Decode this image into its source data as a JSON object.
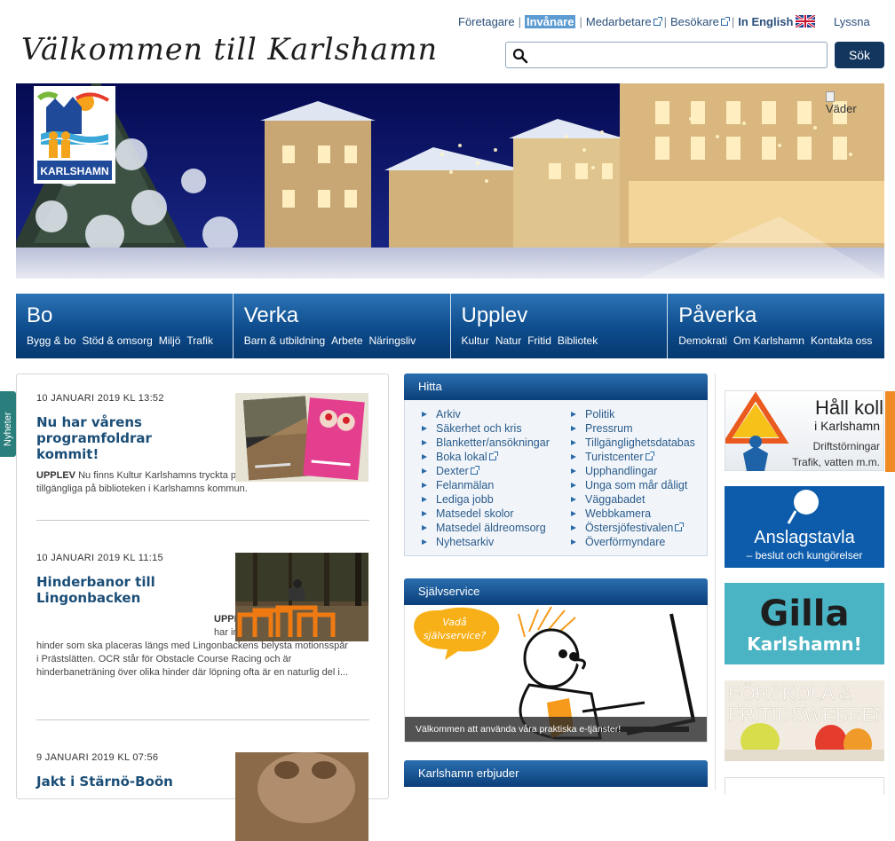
{
  "topnav": {
    "items": [
      "Företagare",
      "Invånare",
      "Medarbetare",
      "Besökare",
      "In English"
    ],
    "lyssna": "Lyssna"
  },
  "header": {
    "headline": "Välkommen till Karlshamn",
    "search_placeholder": "",
    "search_button": "Sök"
  },
  "hero": {
    "logo_text": "KARLSHAMN",
    "weather_alt": "Väder"
  },
  "mainnav": [
    {
      "title": "Bo",
      "subs": [
        "Bygg & bo",
        "Stöd & omsorg",
        "Miljö",
        "Trafik"
      ]
    },
    {
      "title": "Verka",
      "subs": [
        "Barn & utbildning",
        "Arbete",
        "Näringsliv"
      ]
    },
    {
      "title": "Upplev",
      "subs": [
        "Kultur",
        "Natur",
        "Fritid",
        "Bibliotek"
      ]
    },
    {
      "title": "Påverka",
      "subs": [
        "Demokrati",
        "Om Karlshamn",
        "Kontakta oss"
      ]
    }
  ],
  "sidetab": "Nyheter",
  "news": [
    {
      "date": "10 JANUARI 2019 KL 13:52",
      "title": "Nu har vårens programfoldrar kommit!",
      "category": "UPPLEV",
      "text": "Nu finns Kultur Karlshamns tryckta programfoldrar för våren tillgängliga på biblioteken i Karlshamns kommun."
    },
    {
      "date": "10 JANUARI 2019 KL 11:15",
      "title": "Hinderbanor till Lingonbacken",
      "category": "UPPLEV",
      "text": "Karlshamns kommun har inhandlat 12 stycken OCR-hinder som ska placeras längs med Lingonbackens belysta motionsspår i Prästslätten. OCR står för Obstacle Course Racing och är hinderbaneträning över olika hinder där löpning ofta är en naturlig del i..."
    },
    {
      "date": "9 JANUARI 2019 KL 07:56",
      "title": "Jakt i Stärnö-Boön",
      "category": "",
      "text": ""
    }
  ],
  "hitta": {
    "title": "Hitta",
    "left": [
      "Arkiv",
      "Säkerhet och kris",
      "Blanketter/ansökningar",
      "Boka lokal",
      "Dexter",
      "Felanmälan",
      "Lediga jobb",
      "Matsedel skolor",
      "Matsedel äldreomsorg",
      "Nyhetsarkiv"
    ],
    "right": [
      "Politik",
      "Pressrum",
      "Tillgänglighetsdatabas",
      "Turistcenter",
      "Upphandlingar",
      "Unga som mår dåligt",
      "Väggabadet",
      "Webbkamera",
      "Östersjöfestivalen",
      "Överförmyndare"
    ]
  },
  "selfservice": {
    "title": "Självservice",
    "bubble1": "Vadå",
    "bubble2": "självservice?",
    "caption": "Välkommen att använda våra praktiska e-tjänster!"
  },
  "erbjuder": {
    "title": "Karlshamn erbjuder"
  },
  "ads": {
    "ad1_line1": "Håll koll",
    "ad1_line2": "i Karlshamn",
    "ad1_line3": "Driftstörningar",
    "ad1_line4": "Trafik, vatten m.m.",
    "ad2_line1": "Anslagstavla",
    "ad2_line2": "– beslut och kungörelser",
    "ad3_line1": "Gilla",
    "ad3_line2": "Karlshamn!",
    "ad4_line1": "FÖRSKOLA &",
    "ad4_line2": "FRITIDSWEBBEN"
  },
  "colors": {
    "nav_blue": "#0d4b8c",
    "accent_orange": "#f08a24",
    "dark_button": "#13365f"
  }
}
